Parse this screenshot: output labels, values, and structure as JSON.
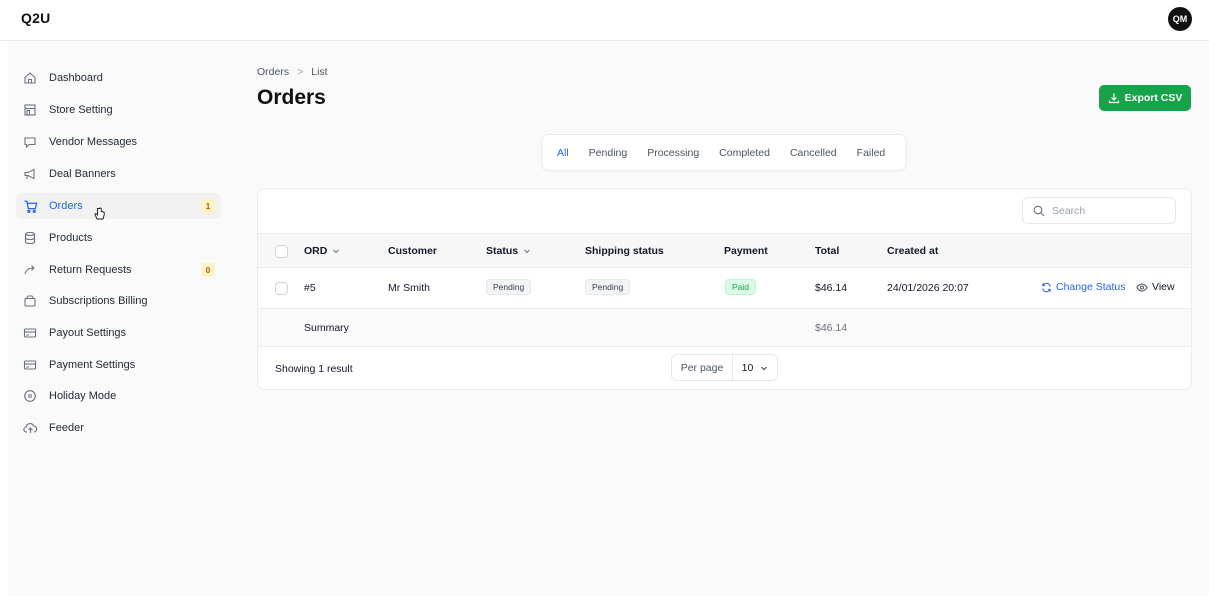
{
  "app": {
    "logo": "Q2U",
    "avatar_initials": "QM"
  },
  "sidebar": {
    "items": [
      {
        "label": "Dashboard",
        "icon": "home-icon"
      },
      {
        "label": "Store Setting",
        "icon": "store-icon"
      },
      {
        "label": "Vendor Messages",
        "icon": "chat-icon"
      },
      {
        "label": "Deal Banners",
        "icon": "megaphone-icon"
      },
      {
        "label": "Orders",
        "icon": "cart-icon",
        "badge": "1",
        "active": true
      },
      {
        "label": "Products",
        "icon": "database-icon"
      },
      {
        "label": "Return Requests",
        "icon": "return-arrow-icon",
        "badge": "0"
      },
      {
        "label": "Subscriptions Billing",
        "icon": "wallet-icon"
      },
      {
        "label": "Payout Settings",
        "icon": "credit-card-icon"
      },
      {
        "label": "Payment Settings",
        "icon": "credit-card-icon"
      },
      {
        "label": "Holiday Mode",
        "icon": "pause-circle-icon"
      },
      {
        "label": "Feeder",
        "icon": "cloud-upload-icon"
      }
    ]
  },
  "breadcrumb": {
    "parent": "Orders",
    "separator": ">",
    "current": "List"
  },
  "page": {
    "title": "Orders",
    "export_label": "Export CSV"
  },
  "tabs": [
    {
      "label": "All",
      "active": true
    },
    {
      "label": "Pending"
    },
    {
      "label": "Processing"
    },
    {
      "label": "Completed"
    },
    {
      "label": "Cancelled"
    },
    {
      "label": "Failed"
    }
  ],
  "search": {
    "placeholder": "Search"
  },
  "table": {
    "headers": {
      "ord": "ORD",
      "customer": "Customer",
      "status": "Status",
      "shipping": "Shipping status",
      "payment": "Payment",
      "total": "Total",
      "created": "Created at"
    },
    "rows": [
      {
        "ord": "#5",
        "customer": "Mr Smith",
        "status": "Pending",
        "shipping": "Pending",
        "payment": "Paid",
        "total": "$46.14",
        "created": "24/01/2026 20:07",
        "change_status_label": "Change Status",
        "view_label": "View"
      }
    ],
    "summary": {
      "label": "Summary",
      "total": "$46.14"
    }
  },
  "footer": {
    "showing": "Showing 1 result",
    "per_page_label": "Per page",
    "per_page_value": "10"
  },
  "colors": {
    "accent": "#2563eb",
    "export": "#16a34a",
    "badge_bg": "#fef3c7",
    "badge_text": "#b45309"
  }
}
